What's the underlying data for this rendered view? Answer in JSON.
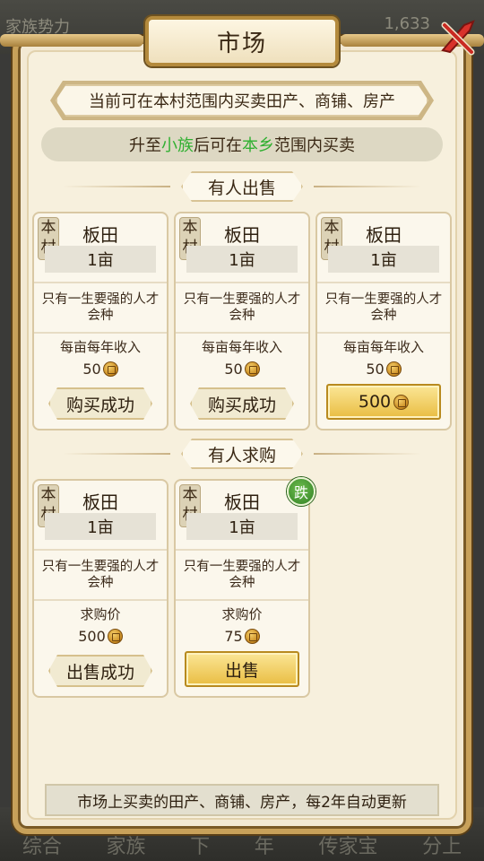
{
  "background": {
    "top_left": "家族势力",
    "top_right": "1,633",
    "nav": [
      "综合",
      "家族",
      "下",
      "年",
      "传家宝",
      "分上"
    ]
  },
  "title": "市场",
  "info_text": "当前可在本村范围内买卖田产、商铺、房产",
  "upgrade": {
    "prefix": "升至",
    "rank": "小族",
    "middle": "后可在",
    "scope": "本乡",
    "suffix": "范围内买卖"
  },
  "sections": {
    "selling_title": "有人出售",
    "buying_title": "有人求购"
  },
  "selling": [
    {
      "badge": "本村",
      "name": "板田",
      "qty": "1亩",
      "desc": "只有一生要强的人才会种",
      "label": "每亩每年收入",
      "price": "50",
      "action": "购买成功"
    },
    {
      "badge": "本村",
      "name": "板田",
      "qty": "1亩",
      "desc": "只有一生要强的人才会种",
      "label": "每亩每年收入",
      "price": "50",
      "action": "购买成功"
    },
    {
      "badge": "本村",
      "name": "板田",
      "qty": "1亩",
      "desc": "只有一生要强的人才会种",
      "label": "每亩每年收入",
      "price": "50",
      "action": "500"
    }
  ],
  "buying": [
    {
      "badge": "本村",
      "name": "板田",
      "qty": "1亩",
      "desc": "只有一生要强的人才会种",
      "label": "求购价",
      "price": "500",
      "action": "出售成功"
    },
    {
      "badge": "本村",
      "name": "板田",
      "qty": "1亩",
      "desc": "只有一生要强的人才会种",
      "label": "求购价",
      "price": "75",
      "action": "出售",
      "tag": "跌"
    }
  ],
  "footer": "市场上买卖的田产、商铺、房产，每2年自动更新",
  "colors": {
    "accent_green": "#31b032",
    "gold": "#e9bd42",
    "frame": "#c8a15a"
  }
}
